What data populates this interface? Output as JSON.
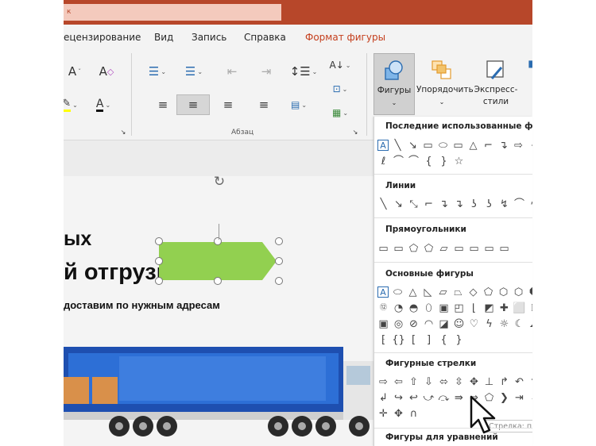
{
  "window": {
    "search_text": "к",
    "accent_color": "#b7472a"
  },
  "menu": {
    "tabs": [
      {
        "label": "ецензирование"
      },
      {
        "label": "Вид"
      },
      {
        "label": "Запись"
      },
      {
        "label": "Справка"
      },
      {
        "label": "Формат фигуры"
      }
    ]
  },
  "ribbon": {
    "paragraph_group_label": "Абзац",
    "shapes_label": "Фигуры",
    "arrange_label": "Упорядочить",
    "quick_styles_label_1": "Экспресс-",
    "quick_styles_label_2": "стили"
  },
  "slide": {
    "line1": "ых",
    "line2": "й отгрузки",
    "line3": "доставим по нужным адресам",
    "shape_color": "#92d050"
  },
  "shapes_panel": {
    "sections": [
      {
        "title": "Последние использованные фигуры"
      },
      {
        "title": "Линии"
      },
      {
        "title": "Прямоугольники"
      },
      {
        "title": "Основные фигуры"
      },
      {
        "title": "Фигурные стрелки"
      },
      {
        "title": "Фигуры для уравнений"
      }
    ],
    "tooltip": "Стрелка: пятиугольник"
  }
}
